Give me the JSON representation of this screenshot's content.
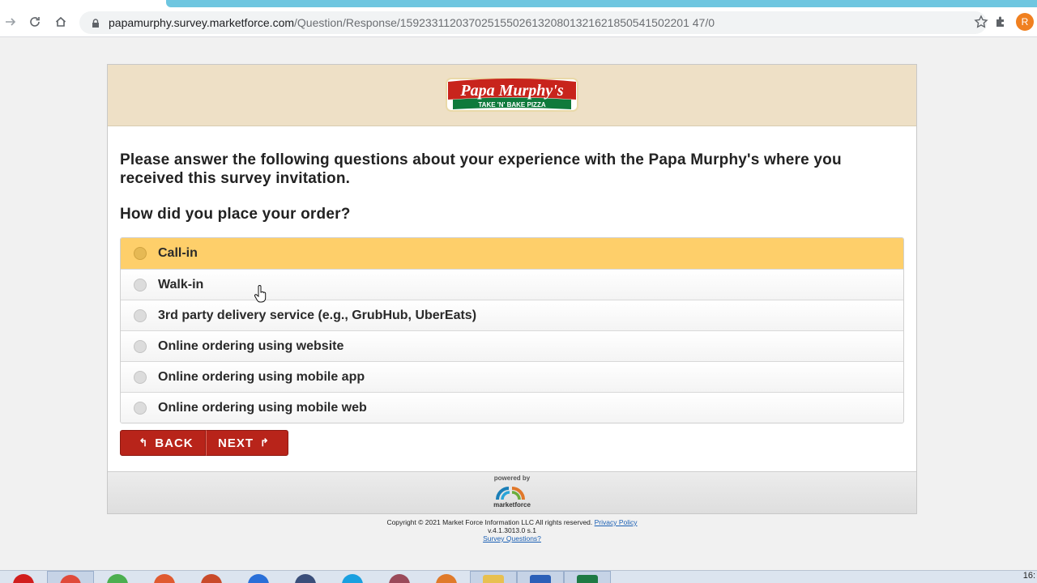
{
  "browser": {
    "url_host": "papamurphy.survey.marketforce.com",
    "url_path": "/Question/Response/1592331120370251550261320801321621850541502201 47/0",
    "avatar_letter": "R"
  },
  "brand": {
    "logo_text": "Papa Murphy's",
    "logo_tagline": "TAKE 'N' BAKE PIZZA",
    "primary": "#b8241a",
    "banner_bg": "#eee0c6",
    "selected_bg": "#fecf6a"
  },
  "survey": {
    "intro": "Please answer the following questions about your experience with the Papa Murphy's where you received this survey invitation.",
    "question": "How did you place your order?",
    "options": [
      {
        "label": "Call-in",
        "selected": true
      },
      {
        "label": "Walk-in",
        "selected": false
      },
      {
        "label": "3rd party delivery service (e.g., GrubHub, UberEats)",
        "selected": false
      },
      {
        "label": "Online ordering using website",
        "selected": false
      },
      {
        "label": "Online ordering using mobile app",
        "selected": false
      },
      {
        "label": "Online ordering using mobile web",
        "selected": false
      }
    ],
    "back_label": "BACK",
    "next_label": "NEXT"
  },
  "footer": {
    "powered_by": "powered by",
    "mf_logo_text": "marketforce",
    "copyright": "Copyright © 2021 Market Force Information LLC All rights reserved.",
    "privacy_link": "Privacy Policy",
    "version": "v.4.1.3013.0 s.1",
    "survey_questions_link": "Survey Questions?"
  },
  "taskbar": {
    "clock": "16:"
  }
}
